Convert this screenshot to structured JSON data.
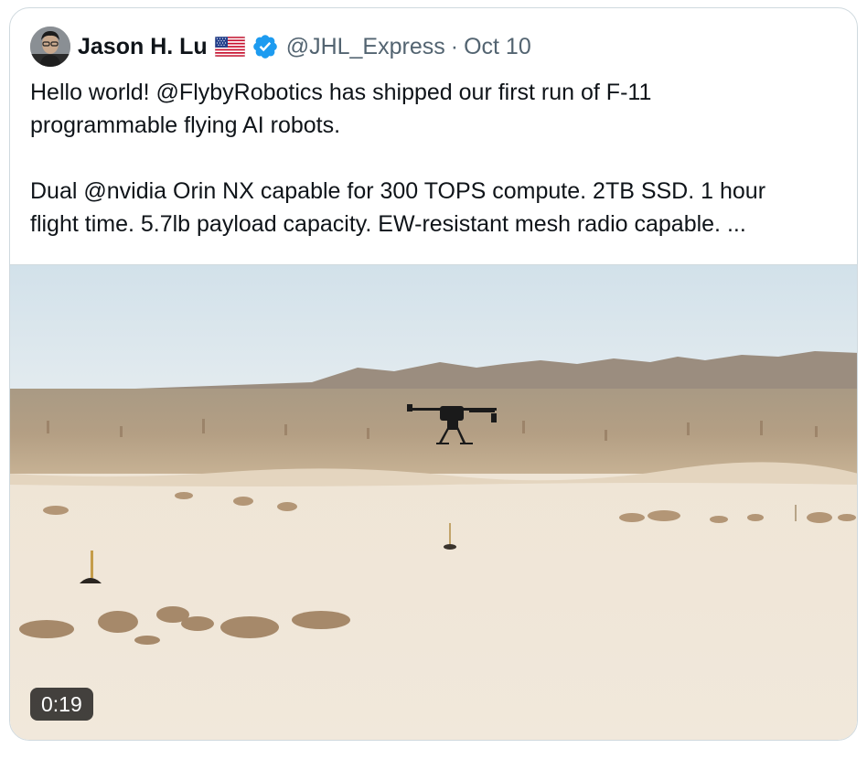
{
  "tweet": {
    "author_name": "Jason H. Lu",
    "handle": "@JHL_Express",
    "separator": "·",
    "date": "Oct 10",
    "flag_icon": "us-flag-icon",
    "verified_color": "#1d9bf0",
    "text_lines_1": [
      "Hello world! @FlybyRobotics has shipped our first run of F-11",
      "programmable flying AI robots."
    ],
    "text_lines_2": [
      "Dual @nvidia Orin NX capable for 300 TOPS compute. 2TB SSD. 1 hour",
      "flight time. 5.7lb payload capacity. EW-resistant mesh radio capable. ..."
    ],
    "video": {
      "duration": "0:19"
    }
  }
}
